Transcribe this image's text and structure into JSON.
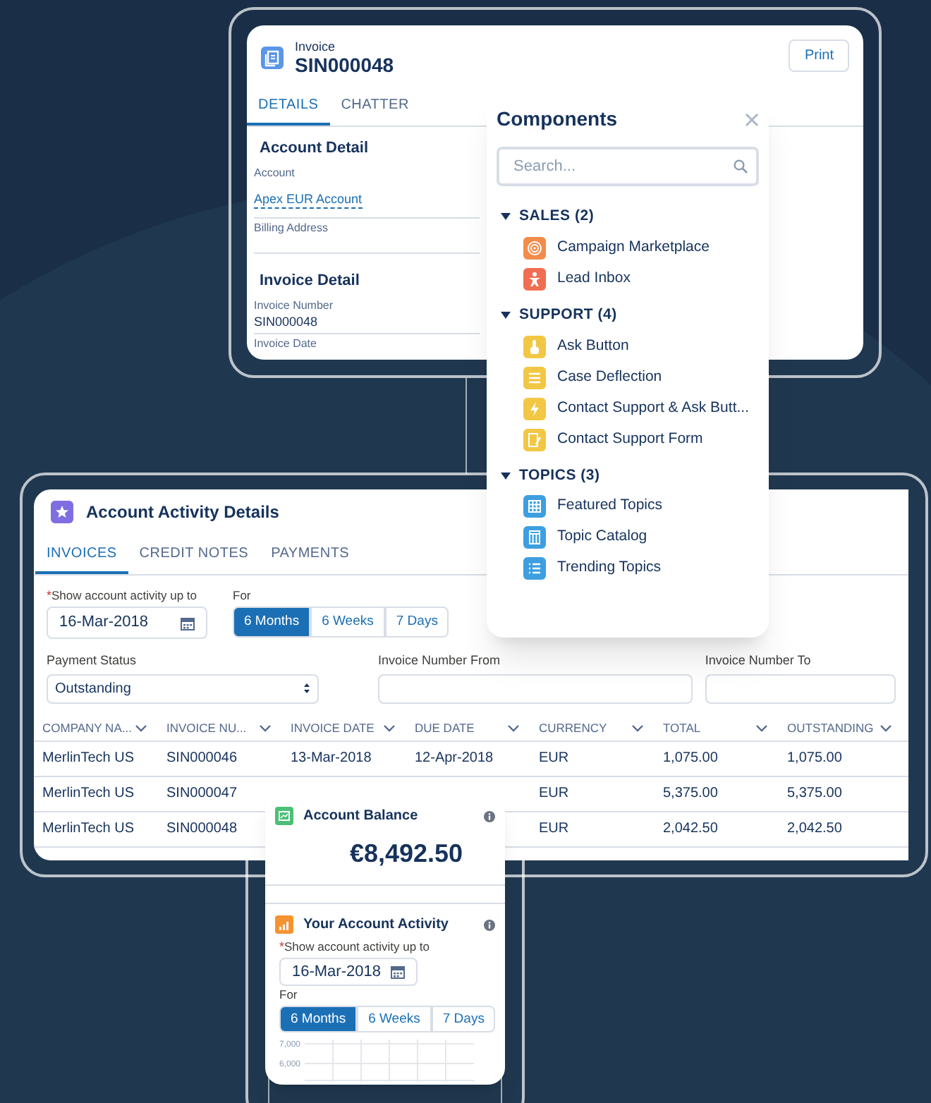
{
  "invoice": {
    "object_label": "Invoice",
    "title": "SIN000048",
    "print_button": "Print",
    "tabs": [
      {
        "label": "DETAILS",
        "selected": true
      },
      {
        "label": "CHATTER",
        "selected": false
      }
    ],
    "sections": [
      {
        "heading": "Account Detail",
        "fields": [
          {
            "label": "Account",
            "value": "Apex EUR Account",
            "kind": "link"
          },
          {
            "label": "Billing Address"
          }
        ]
      },
      {
        "heading": "Invoice Detail",
        "fields": [
          {
            "label": "Invoice Number",
            "value": "SIN000048",
            "kind": "text"
          },
          {
            "label": "Invoice Date"
          }
        ]
      }
    ]
  },
  "components": {
    "title": "Components",
    "search": {
      "placeholder": "Search..."
    },
    "groups": [
      {
        "label": "SALES (2)",
        "expanded": true,
        "items": [
          {
            "label": "Campaign Marketplace",
            "color": "#f38b4a"
          },
          {
            "label": "Lead Inbox",
            "color": "#f26e52"
          }
        ]
      },
      {
        "label": "SUPPORT (4)",
        "expanded": true,
        "items": [
          {
            "label": "Ask Button",
            "color": "#f2c744"
          },
          {
            "label": "Case Deflection",
            "color": "#f2c744"
          },
          {
            "label": "Contact Support & Ask Butt...",
            "color": "#f2c744"
          },
          {
            "label": "Contact Support Form",
            "color": "#f2c744"
          }
        ]
      },
      {
        "label": "TOPICS (3)",
        "expanded": true,
        "items": [
          {
            "label": "Featured Topics",
            "color": "#3d9fe0"
          },
          {
            "label": "Topic Catalog",
            "color": "#3d9fe0"
          },
          {
            "label": "Trending Topics",
            "color": "#3d9fe0"
          }
        ]
      }
    ]
  },
  "activity": {
    "title": "Account Activity Details",
    "tabs": [
      {
        "label": "INVOICES",
        "selected": true
      },
      {
        "label": "CREDIT NOTES",
        "selected": false
      },
      {
        "label": "PAYMENTS",
        "selected": false
      }
    ],
    "date_filter": {
      "required_mark": "*",
      "label": "Show account activity up to",
      "value": "16-Mar-2018"
    },
    "period": {
      "label": "For",
      "options": [
        {
          "label": "6 Months",
          "selected": true
        },
        {
          "label": "6 Weeks",
          "selected": false
        },
        {
          "label": "7 Days",
          "selected": false
        }
      ]
    },
    "payment_status": {
      "label": "Payment Status",
      "value": "Outstanding"
    },
    "invoice_from": {
      "label": "Invoice Number From"
    },
    "invoice_to": {
      "label": "Invoice Number To"
    },
    "table": {
      "columns": [
        "COMPANY NA...",
        "INVOICE NU...",
        "INVOICE DATE",
        "DUE DATE",
        "CURRENCY",
        "TOTAL",
        "OUTSTANDING"
      ],
      "rows": [
        [
          "MerlinTech US",
          "SIN000046",
          "13-Mar-2018",
          "12-Apr-2018",
          "EUR",
          "1,075.00",
          "1,075.00"
        ],
        [
          "MerlinTech US",
          "SIN000047",
          null,
          null,
          "EUR",
          "5,375.00",
          "5,375.00"
        ],
        [
          "MerlinTech US",
          "SIN000048",
          null,
          null,
          "EUR",
          "2,042.50",
          "2,042.50"
        ]
      ]
    }
  },
  "balance": {
    "title": "Account Balance",
    "amount": "€8,492.50",
    "activity_title": "Your Account Activity",
    "date_filter": {
      "required_mark": "*",
      "label": "Show account activity up to",
      "value": "16-Mar-2018"
    },
    "period": {
      "label": "For",
      "options": [
        {
          "label": "6 Months",
          "selected": true
        },
        {
          "label": "6 Weeks",
          "selected": false
        },
        {
          "label": "7 Days",
          "selected": false
        }
      ]
    },
    "chart_axis_labels": [
      "7,000",
      "6,000"
    ]
  }
}
